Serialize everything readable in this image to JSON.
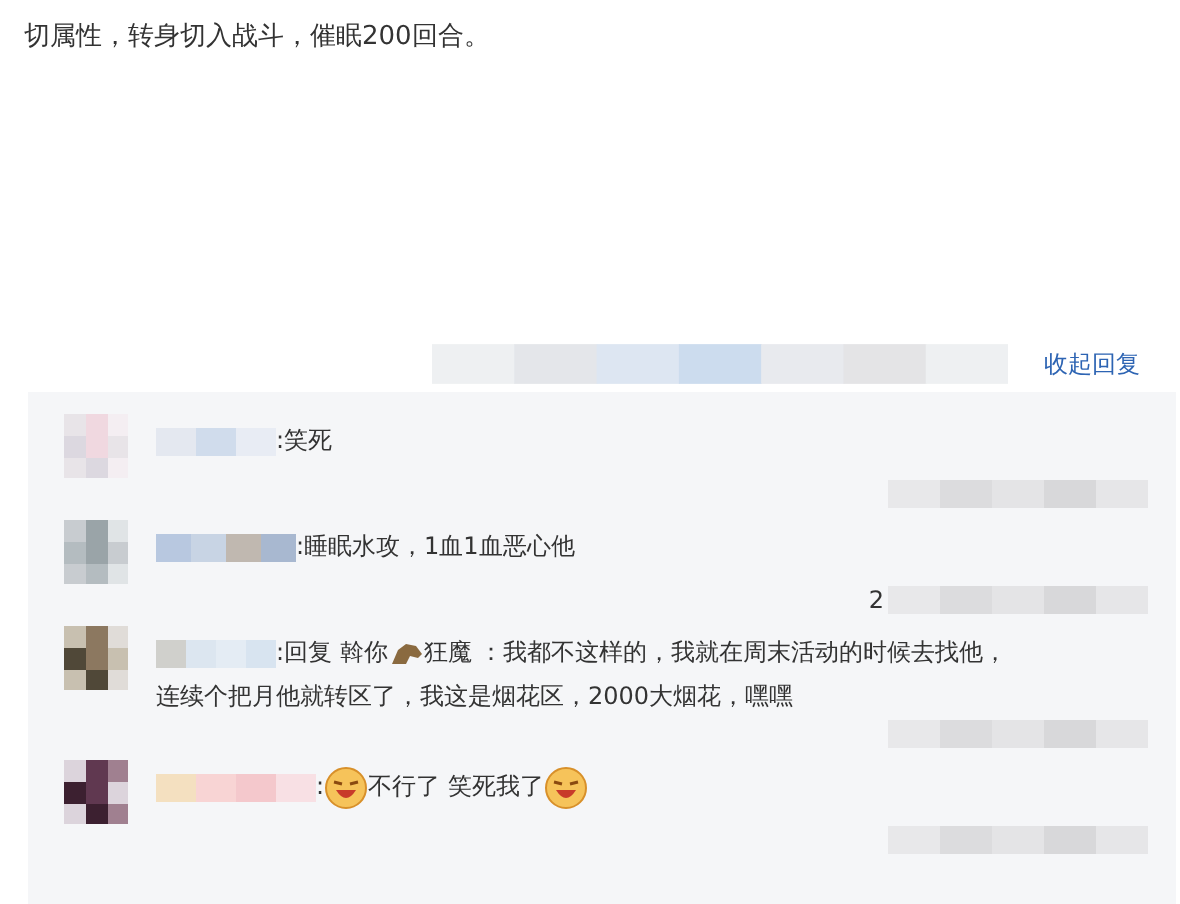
{
  "post": {
    "text": "切属性，转身切入战斗，催眠200回合。"
  },
  "reply_panel": {
    "collapse_label": "收起回复",
    "comments": [
      {
        "segments": [
          {
            "kind": "text",
            "text": ":笑死"
          }
        ]
      },
      {
        "segments": [
          {
            "kind": "text",
            "text": ":睡眠水攻，1血1血恶心他"
          }
        ],
        "time_prefix": "2"
      },
      {
        "segments": [
          {
            "kind": "text",
            "text": ":回复 斡你"
          },
          {
            "kind": "horse-emoji"
          },
          {
            "kind": "text",
            "text": "狂魔 ：我都不这样的，我就在周末活动的时候去找他，"
          },
          {
            "kind": "text",
            "text": "连续个把月他就转区了，我这是烟花区，2000大烟花，嘿嘿",
            "new_line": true
          }
        ]
      },
      {
        "segments": [
          {
            "kind": "text",
            "text": ":"
          },
          {
            "kind": "laugh-emoji"
          },
          {
            "kind": "text",
            "text": "不行了 笑死我了"
          },
          {
            "kind": "laugh-emoji"
          }
        ]
      }
    ]
  }
}
